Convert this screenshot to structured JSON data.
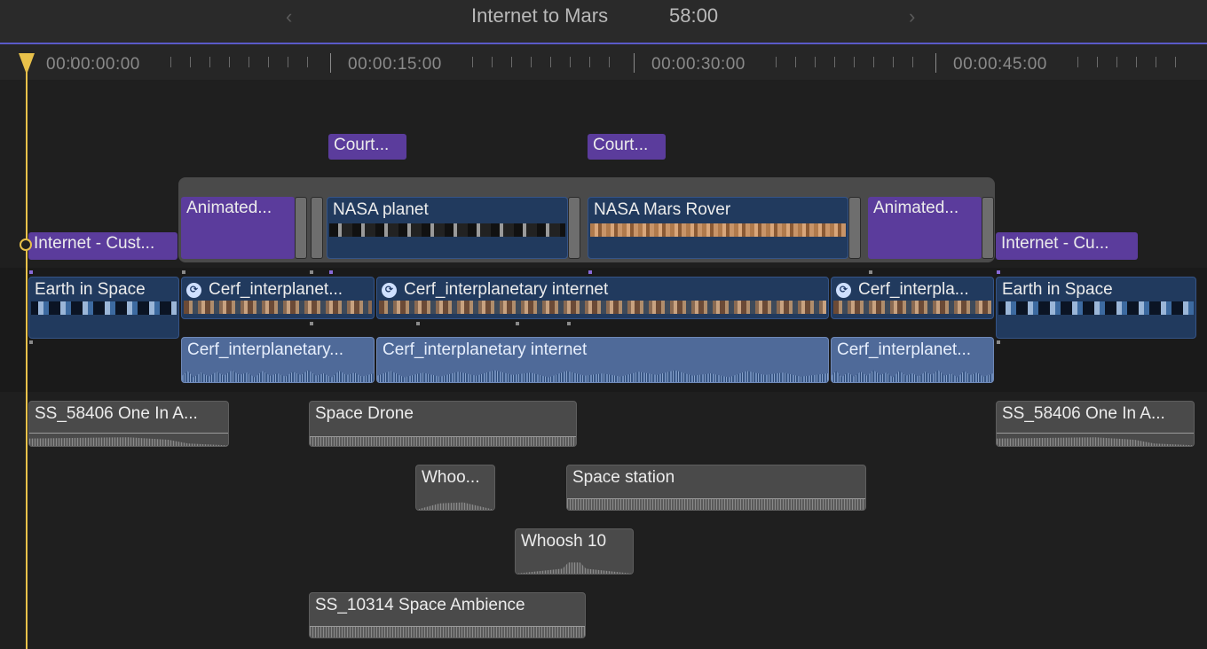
{
  "header": {
    "project_title": "Internet to Mars",
    "duration": "58:00",
    "prev_arrow": "‹",
    "next_arrow": "›"
  },
  "ruler": {
    "timecodes": [
      "00:00:00:00",
      "00:00:15:00",
      "00:00:30:00",
      "00:00:45:00"
    ]
  },
  "titles": {
    "courtesy_1": "Court...",
    "courtesy_2": "Court...",
    "animated_1": "Animated...",
    "animated_2": "Animated...",
    "internet_1": "Internet - Cust...",
    "internet_2": "Internet - Cu..."
  },
  "connected_video": {
    "nasa_planet": "NASA planet",
    "nasa_mars_rover": "NASA Mars Rover"
  },
  "primary_storyline": {
    "earth_1": "Earth in Space",
    "cerf_1": "Cerf_interplanet...",
    "cerf_2": "Cerf_interplanetary internet",
    "cerf_3": "Cerf_interpla...",
    "earth_2": "Earth in Space"
  },
  "attached_audio": {
    "cerf_a1": "Cerf_interplanetary...",
    "cerf_a2": "Cerf_interplanetary internet",
    "cerf_a3": "Cerf_interplanet..."
  },
  "audio_clips": {
    "ss58406_1": "SS_58406 One In A...",
    "space_drone": "Space Drone",
    "ss58406_2": "SS_58406 One In A...",
    "whoosh_short": "Whoo...",
    "space_station": "Space station",
    "whoosh_10": "Whoosh 10",
    "space_ambience": "SS_10314 Space Ambience"
  },
  "colors": {
    "title_clip": "#5b3c9c",
    "video_clip": "#213a5e",
    "attached_audio": "#4f6a99",
    "audio_clip": "#4a4a4a",
    "playhead": "#e8c14a",
    "header_divider": "#5a5ac8"
  },
  "icons": {
    "connection": "connection-icon",
    "playhead": "playhead-icon"
  }
}
